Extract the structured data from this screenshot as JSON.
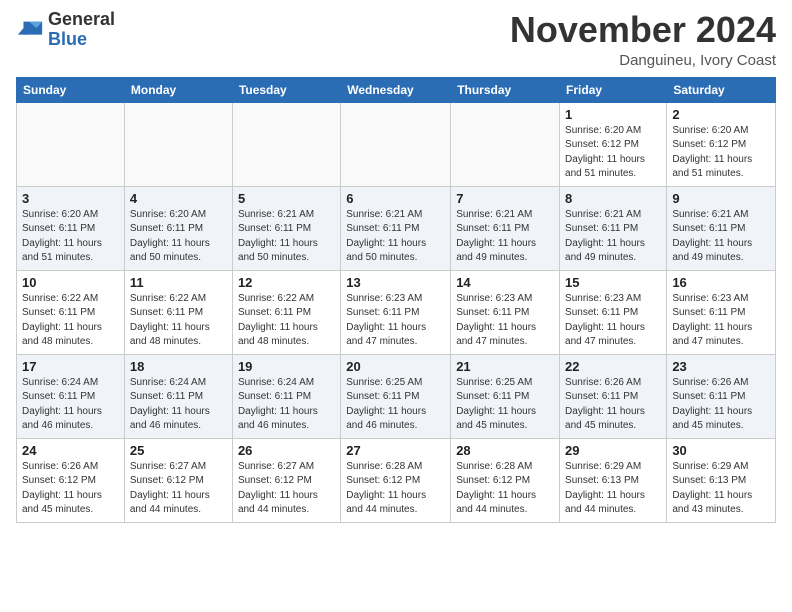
{
  "header": {
    "logo_line1": "General",
    "logo_line2": "Blue",
    "month_title": "November 2024",
    "location": "Danguineu, Ivory Coast"
  },
  "days_of_week": [
    "Sunday",
    "Monday",
    "Tuesday",
    "Wednesday",
    "Thursday",
    "Friday",
    "Saturday"
  ],
  "weeks": [
    [
      {
        "day": "",
        "info": ""
      },
      {
        "day": "",
        "info": ""
      },
      {
        "day": "",
        "info": ""
      },
      {
        "day": "",
        "info": ""
      },
      {
        "day": "",
        "info": ""
      },
      {
        "day": "1",
        "info": "Sunrise: 6:20 AM\nSunset: 6:12 PM\nDaylight: 11 hours\nand 51 minutes."
      },
      {
        "day": "2",
        "info": "Sunrise: 6:20 AM\nSunset: 6:12 PM\nDaylight: 11 hours\nand 51 minutes."
      }
    ],
    [
      {
        "day": "3",
        "info": "Sunrise: 6:20 AM\nSunset: 6:11 PM\nDaylight: 11 hours\nand 51 minutes."
      },
      {
        "day": "4",
        "info": "Sunrise: 6:20 AM\nSunset: 6:11 PM\nDaylight: 11 hours\nand 50 minutes."
      },
      {
        "day": "5",
        "info": "Sunrise: 6:21 AM\nSunset: 6:11 PM\nDaylight: 11 hours\nand 50 minutes."
      },
      {
        "day": "6",
        "info": "Sunrise: 6:21 AM\nSunset: 6:11 PM\nDaylight: 11 hours\nand 50 minutes."
      },
      {
        "day": "7",
        "info": "Sunrise: 6:21 AM\nSunset: 6:11 PM\nDaylight: 11 hours\nand 49 minutes."
      },
      {
        "day": "8",
        "info": "Sunrise: 6:21 AM\nSunset: 6:11 PM\nDaylight: 11 hours\nand 49 minutes."
      },
      {
        "day": "9",
        "info": "Sunrise: 6:21 AM\nSunset: 6:11 PM\nDaylight: 11 hours\nand 49 minutes."
      }
    ],
    [
      {
        "day": "10",
        "info": "Sunrise: 6:22 AM\nSunset: 6:11 PM\nDaylight: 11 hours\nand 48 minutes."
      },
      {
        "day": "11",
        "info": "Sunrise: 6:22 AM\nSunset: 6:11 PM\nDaylight: 11 hours\nand 48 minutes."
      },
      {
        "day": "12",
        "info": "Sunrise: 6:22 AM\nSunset: 6:11 PM\nDaylight: 11 hours\nand 48 minutes."
      },
      {
        "day": "13",
        "info": "Sunrise: 6:23 AM\nSunset: 6:11 PM\nDaylight: 11 hours\nand 47 minutes."
      },
      {
        "day": "14",
        "info": "Sunrise: 6:23 AM\nSunset: 6:11 PM\nDaylight: 11 hours\nand 47 minutes."
      },
      {
        "day": "15",
        "info": "Sunrise: 6:23 AM\nSunset: 6:11 PM\nDaylight: 11 hours\nand 47 minutes."
      },
      {
        "day": "16",
        "info": "Sunrise: 6:23 AM\nSunset: 6:11 PM\nDaylight: 11 hours\nand 47 minutes."
      }
    ],
    [
      {
        "day": "17",
        "info": "Sunrise: 6:24 AM\nSunset: 6:11 PM\nDaylight: 11 hours\nand 46 minutes."
      },
      {
        "day": "18",
        "info": "Sunrise: 6:24 AM\nSunset: 6:11 PM\nDaylight: 11 hours\nand 46 minutes."
      },
      {
        "day": "19",
        "info": "Sunrise: 6:24 AM\nSunset: 6:11 PM\nDaylight: 11 hours\nand 46 minutes."
      },
      {
        "day": "20",
        "info": "Sunrise: 6:25 AM\nSunset: 6:11 PM\nDaylight: 11 hours\nand 46 minutes."
      },
      {
        "day": "21",
        "info": "Sunrise: 6:25 AM\nSunset: 6:11 PM\nDaylight: 11 hours\nand 45 minutes."
      },
      {
        "day": "22",
        "info": "Sunrise: 6:26 AM\nSunset: 6:11 PM\nDaylight: 11 hours\nand 45 minutes."
      },
      {
        "day": "23",
        "info": "Sunrise: 6:26 AM\nSunset: 6:11 PM\nDaylight: 11 hours\nand 45 minutes."
      }
    ],
    [
      {
        "day": "24",
        "info": "Sunrise: 6:26 AM\nSunset: 6:12 PM\nDaylight: 11 hours\nand 45 minutes."
      },
      {
        "day": "25",
        "info": "Sunrise: 6:27 AM\nSunset: 6:12 PM\nDaylight: 11 hours\nand 44 minutes."
      },
      {
        "day": "26",
        "info": "Sunrise: 6:27 AM\nSunset: 6:12 PM\nDaylight: 11 hours\nand 44 minutes."
      },
      {
        "day": "27",
        "info": "Sunrise: 6:28 AM\nSunset: 6:12 PM\nDaylight: 11 hours\nand 44 minutes."
      },
      {
        "day": "28",
        "info": "Sunrise: 6:28 AM\nSunset: 6:12 PM\nDaylight: 11 hours\nand 44 minutes."
      },
      {
        "day": "29",
        "info": "Sunrise: 6:29 AM\nSunset: 6:13 PM\nDaylight: 11 hours\nand 44 minutes."
      },
      {
        "day": "30",
        "info": "Sunrise: 6:29 AM\nSunset: 6:13 PM\nDaylight: 11 hours\nand 43 minutes."
      }
    ]
  ]
}
